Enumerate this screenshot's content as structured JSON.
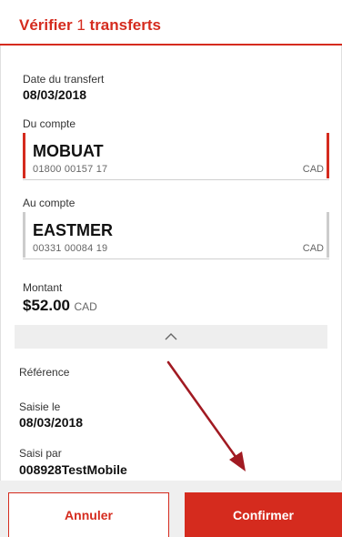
{
  "header": {
    "title_prefix": "Vérifier",
    "count": "1",
    "title_suffix": "transferts"
  },
  "transfer_date": {
    "label": "Date du transfert",
    "value": "08/03/2018"
  },
  "from_account": {
    "label": "Du compte",
    "name": "MOBUAT",
    "number": "01800 00157 17",
    "currency": "CAD",
    "accent_color": "#d52b1e"
  },
  "to_account": {
    "label": "Au compte",
    "name": "EASTMER",
    "number": "00331 00084 19",
    "currency": "CAD",
    "accent_color": "#cccccc"
  },
  "amount": {
    "label": "Montant",
    "value": "$52.00",
    "currency": "CAD"
  },
  "collapse": {
    "icon": "chevron-up-icon"
  },
  "reference": {
    "label": "Référence"
  },
  "entered_on": {
    "label": "Saisie le",
    "value": "08/03/2018"
  },
  "entered_by": {
    "label": "Saisi par",
    "value": "008928TestMobile"
  },
  "footer": {
    "cancel_label": "Annuler",
    "confirm_label": "Confirmer"
  },
  "colors": {
    "brand": "#d52b1e",
    "annotation_arrow": "#a11a22"
  }
}
